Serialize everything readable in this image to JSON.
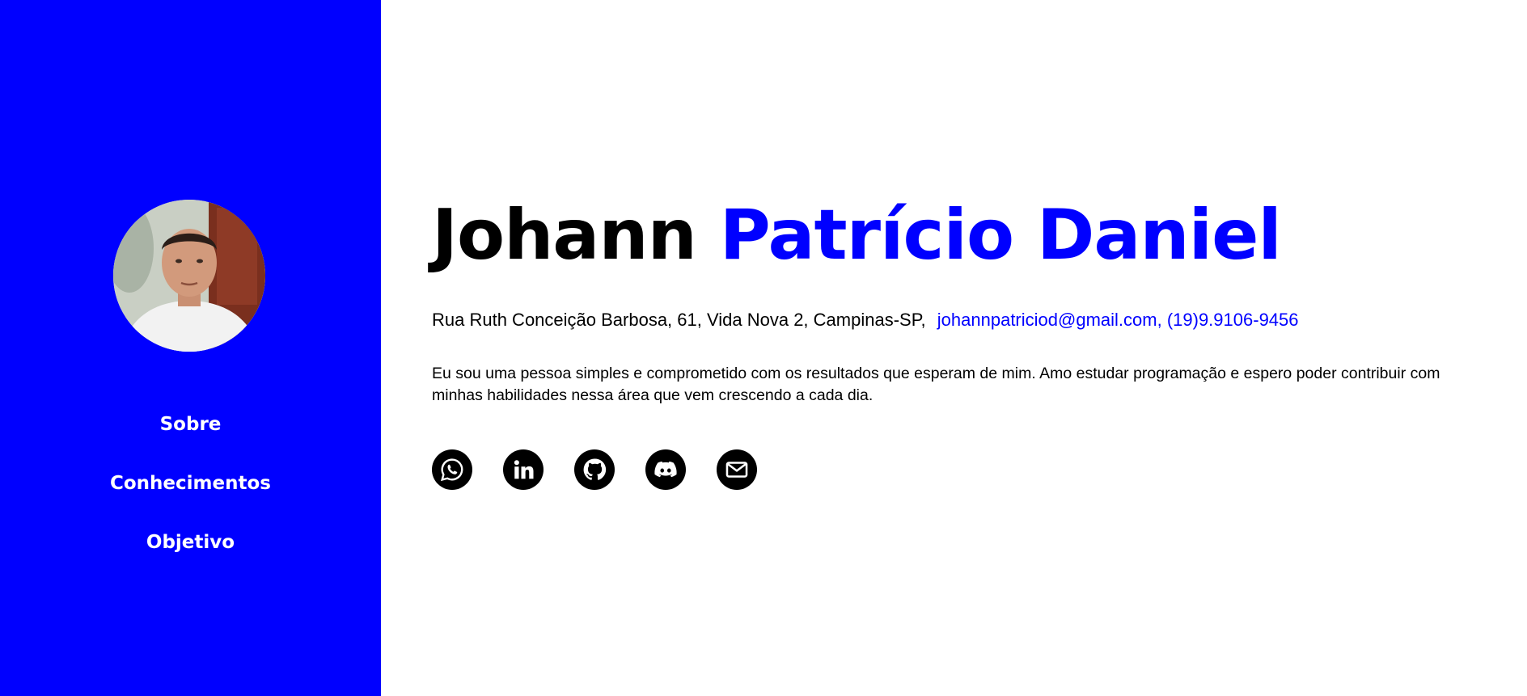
{
  "colors": {
    "accent": "#0000ff",
    "text": "#000000",
    "background": "#ffffff"
  },
  "sidebar": {
    "avatar_icon": "profile-photo",
    "nav": [
      {
        "label": "Sobre"
      },
      {
        "label": "Conhecimentos"
      },
      {
        "label": "Objetivo"
      }
    ]
  },
  "header": {
    "first_name": "Johann",
    "last_names": "Patrício Daniel"
  },
  "contact": {
    "address": "Rua Ruth Conceição Barbosa, 61,  Vida Nova 2,  Campinas-SP,",
    "email": "johannpatriciod@gmail.com,",
    "phone": "(19)9.9106-9456"
  },
  "about": {
    "text": "Eu sou uma pessoa simples e comprometido com os resultados que esperam de mim.  Amo estudar programação e espero poder contribuir com minhas habilidades nessa área que vem crescendo a cada dia."
  },
  "socials": [
    {
      "icon": "whatsapp-icon"
    },
    {
      "icon": "linkedin-icon"
    },
    {
      "icon": "github-icon"
    },
    {
      "icon": "discord-icon"
    },
    {
      "icon": "mail-icon"
    }
  ]
}
